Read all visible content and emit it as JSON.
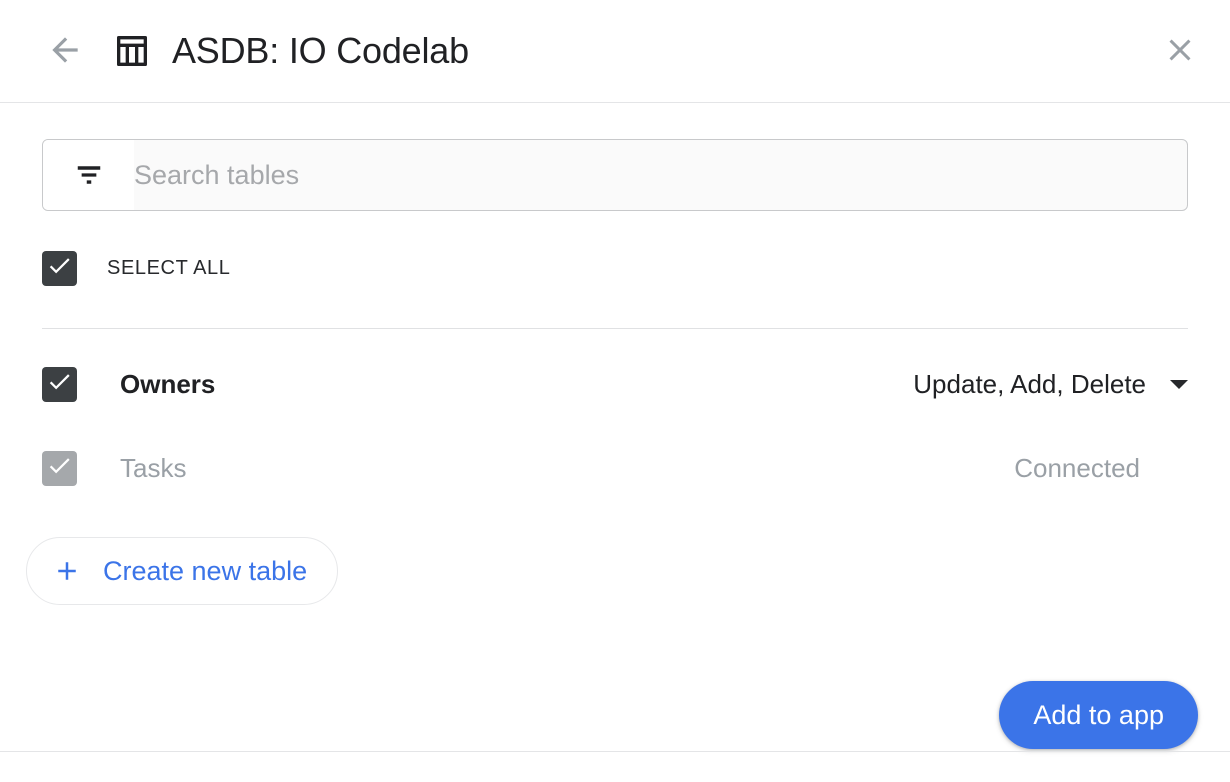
{
  "header": {
    "back_icon": "arrow-left-icon",
    "app_icon": "table-icon",
    "title": "ASDB: IO Codelab",
    "close_icon": "close-icon"
  },
  "search": {
    "icon": "filter-list-icon",
    "value": "",
    "placeholder": "Search tables"
  },
  "select_all": {
    "label": "SELECT ALL",
    "checked": true
  },
  "tables": [
    {
      "name": "Owners",
      "checked": true,
      "disabled": false,
      "permissions": "Update, Add, Delete",
      "caret_icon": "chevron-down-icon"
    },
    {
      "name": "Tasks",
      "checked": true,
      "disabled": true,
      "status": "Connected"
    }
  ],
  "create_table": {
    "icon": "plus-icon",
    "label": "Create new table"
  },
  "footer": {
    "primary_label": "Add to app"
  },
  "colors": {
    "accent": "#3b74e8",
    "checkbox_checked": "#3c4043",
    "checkbox_disabled": "#a5a8ab",
    "muted_text": "#9aa0a6"
  }
}
